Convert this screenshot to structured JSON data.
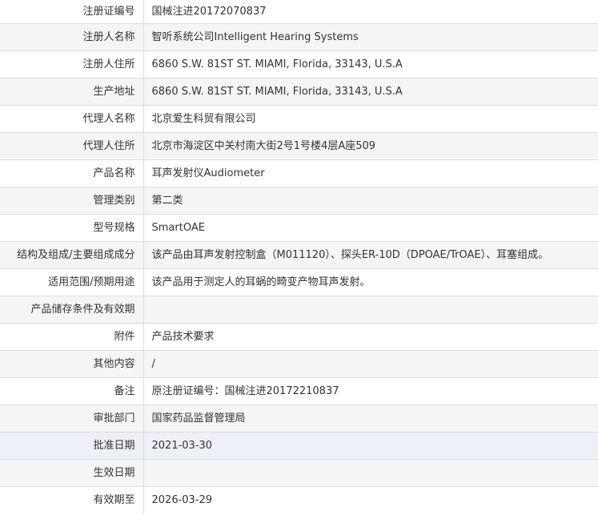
{
  "rows": [
    {
      "label": "注册证编号",
      "value": "国械注进20172070837"
    },
    {
      "label": "注册人名称",
      "value": "智听系统公司Intelligent Hearing Systems"
    },
    {
      "label": "注册人住所",
      "value": "6860 S.W. 81ST ST. MIAMI, Florida, 33143, U.S.A"
    },
    {
      "label": "生产地址",
      "value": "6860 S.W. 81ST ST. MIAMI, Florida, 33143, U.S.A"
    },
    {
      "label": "代理人名称",
      "value": "北京爱生科贸有限公司"
    },
    {
      "label": "代理人住所",
      "value": "北京市海淀区中关村南大街2号1号楼4层A座509"
    },
    {
      "label": "产品名称",
      "value": "耳声发射仪Audiometer"
    },
    {
      "label": "管理类别",
      "value": "第二类"
    },
    {
      "label": "型号规格",
      "value": "SmartOAE"
    },
    {
      "label": "结构及组成/主要组成成分",
      "value": "该产品由耳声发射控制盒（M011120）、探头ER-10D（DPOAE/TrOAE）、耳塞组成。"
    },
    {
      "label": "适用范围/预期用途",
      "value": "该产品用于测定人的耳蜗的畸变产物耳声发射。"
    },
    {
      "label": "产品储存条件及有效期",
      "value": ""
    },
    {
      "label": "附件",
      "value": "产品技术要求"
    },
    {
      "label": "其他内容",
      "value": "/"
    },
    {
      "label": "备注",
      "value": "原注册证编号：国械注进20172210837"
    },
    {
      "label": "审批部门",
      "value": "国家药品监督管理局"
    },
    {
      "label": "批准日期",
      "value": "2021-03-30"
    },
    {
      "label": "生效日期",
      "value": ""
    },
    {
      "label": "有效期至",
      "value": "2026-03-29"
    }
  ]
}
